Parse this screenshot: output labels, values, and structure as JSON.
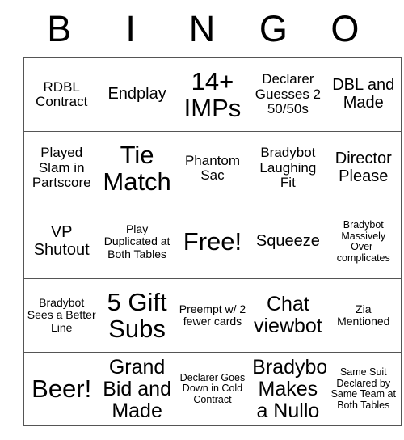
{
  "header": {
    "letters": [
      "B",
      "I",
      "N",
      "G",
      "O"
    ]
  },
  "grid": {
    "rows": [
      [
        {
          "text": "RDBL Contract",
          "size": "fs-sm"
        },
        {
          "text": "Endplay",
          "size": "fs-md"
        },
        {
          "text": "14+ IMPs",
          "size": "fs-xl"
        },
        {
          "text": "Declarer Guesses 2 50/50s",
          "size": "fs-sm"
        },
        {
          "text": "DBL and Made",
          "size": "fs-md"
        }
      ],
      [
        {
          "text": "Played Slam in Partscore",
          "size": "fs-sm"
        },
        {
          "text": "Tie Match",
          "size": "fs-xl"
        },
        {
          "text": "Phantom Sac",
          "size": "fs-sm"
        },
        {
          "text": "Bradybot Laughing Fit",
          "size": "fs-sm"
        },
        {
          "text": "Director Please",
          "size": "fs-md"
        }
      ],
      [
        {
          "text": "VP Shutout",
          "size": "fs-md"
        },
        {
          "text": "Play Duplicated at Both Tables",
          "size": "fs-xs"
        },
        {
          "text": "Free!",
          "size": "fs-xl"
        },
        {
          "text": "Squeeze",
          "size": "fs-md"
        },
        {
          "text": "Bradybot Massively Over-complicates",
          "size": "fs-xxs"
        }
      ],
      [
        {
          "text": "Bradybot Sees a Better Line",
          "size": "fs-xs"
        },
        {
          "text": "5 Gift Subs",
          "size": "fs-xl"
        },
        {
          "text": "Preempt w/ 2 fewer cards",
          "size": "fs-xs"
        },
        {
          "text": "Chat viewbot",
          "size": "fs-lg"
        },
        {
          "text": "Zia Mentioned",
          "size": "fs-xs"
        }
      ],
      [
        {
          "text": "Beer!",
          "size": "fs-xl"
        },
        {
          "text": "Grand Bid and Made",
          "size": "fs-lg"
        },
        {
          "text": "Declarer Goes Down in Cold Contract",
          "size": "fs-xxs"
        },
        {
          "text": "Bradybot Makes a Nullo",
          "size": "fs-lg"
        },
        {
          "text": "Same Suit Declared by Same Team at Both Tables",
          "size": "fs-xxs"
        }
      ]
    ]
  },
  "colors": {
    "background": "#ffffff",
    "text": "#000000",
    "border": "#555555"
  }
}
